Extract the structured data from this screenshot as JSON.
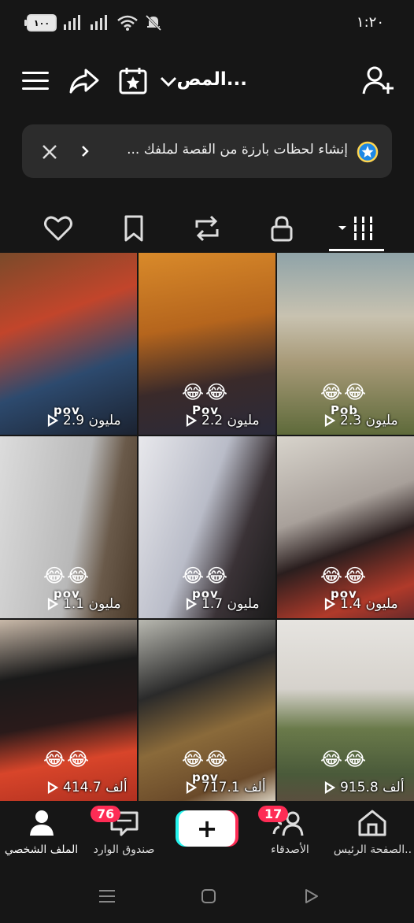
{
  "status_bar": {
    "battery": "١٠٠",
    "time": "١:٢٠"
  },
  "header": {
    "profile_name": "المص..."
  },
  "banner": {
    "text": "إنشاء لحظات بارزة من القصة لملفك ..."
  },
  "tabs": [
    {
      "name": "videos",
      "icon": "grid-icon",
      "active": true
    },
    {
      "name": "private",
      "icon": "lock-icon"
    },
    {
      "name": "reposts",
      "icon": "repost-icon"
    },
    {
      "name": "favorites",
      "icon": "bookmark-icon"
    },
    {
      "name": "liked",
      "icon": "heart-icon"
    }
  ],
  "videos": [
    {
      "views": "2.9 مليون",
      "overlay": "pov",
      "emoji": ""
    },
    {
      "views": "2.2 مليون",
      "overlay": "Pov",
      "emoji": "😂😂"
    },
    {
      "views": "2.3 مليون",
      "overlay": "Pob",
      "emoji": "😂😂"
    },
    {
      "views": "1.1 مليون",
      "overlay": "pov",
      "emoji": "😂😂"
    },
    {
      "views": "1.7 مليون",
      "overlay": "pov",
      "emoji": "😂😂"
    },
    {
      "views": "1.4 مليون",
      "overlay": "pov",
      "emoji": "😂😂"
    },
    {
      "views": "414.7 ألف",
      "overlay": "",
      "emoji": "😂😂"
    },
    {
      "views": "717.1 ألف",
      "overlay": "pov",
      "emoji": "😂😂"
    },
    {
      "views": "915.8 ألف",
      "overlay": "",
      "emoji": "😂😂"
    }
  ],
  "bottom_nav": {
    "home": "الصفحة الرئيس..",
    "friends": "الأصدقاء",
    "friends_badge": "17",
    "create": "+",
    "inbox": "صندوق الوارد",
    "inbox_badge": "76",
    "profile": "الملف الشخصي"
  },
  "colors": {
    "accent": "#fe2c55",
    "cyan": "#25f4ee",
    "background": "#161616"
  }
}
